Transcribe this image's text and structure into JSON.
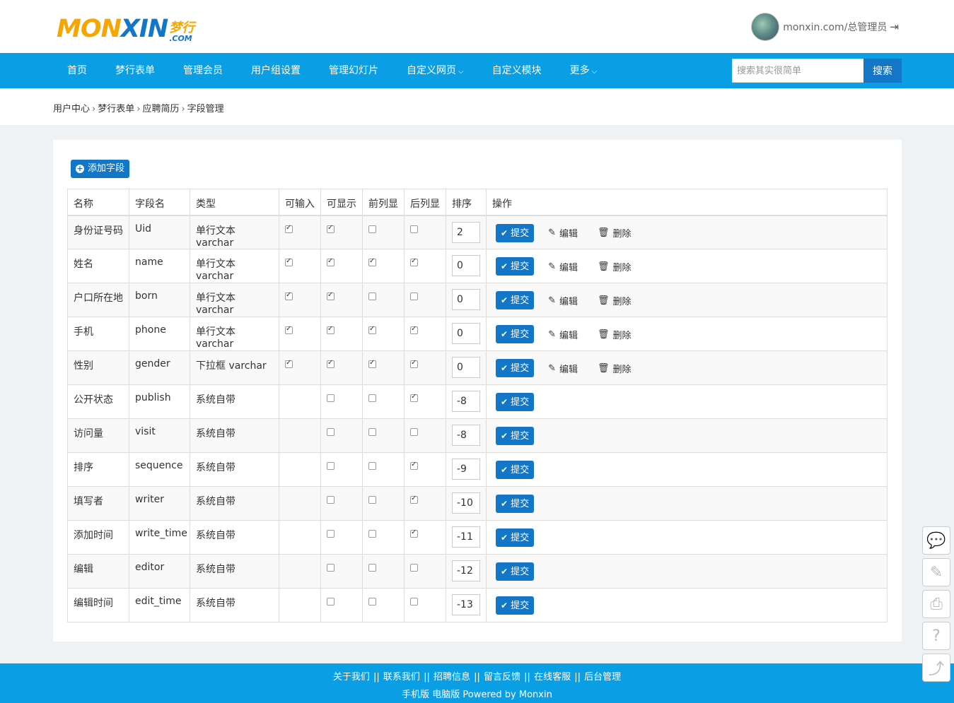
{
  "brand": {
    "mon": "MON",
    "xin": "XIN",
    "cn": "梦行",
    "com": ".COM"
  },
  "user": {
    "label": "monxin.com/总管理员",
    "logout_icon": "sign-out-icon"
  },
  "nav": {
    "items": [
      {
        "label": "首页",
        "dropdown": false
      },
      {
        "label": "梦行表单",
        "dropdown": false
      },
      {
        "label": "管理会员",
        "dropdown": false
      },
      {
        "label": "用户组设置",
        "dropdown": false
      },
      {
        "label": "管理幻灯片",
        "dropdown": false
      },
      {
        "label": "自定义网页",
        "dropdown": true
      },
      {
        "label": "自定义模块",
        "dropdown": false
      },
      {
        "label": "更多",
        "dropdown": true
      }
    ],
    "search_placeholder": "搜索其实很简单",
    "search_button": "搜索"
  },
  "breadcrumb": [
    "用户中心",
    "梦行表单",
    "应聘简历",
    "字段管理"
  ],
  "add_button": "添加字段",
  "table": {
    "headers": [
      "名称",
      "字段名",
      "类型",
      "可输入",
      "可显示",
      "前列显",
      "后列显",
      "排序",
      "操作"
    ],
    "rows": [
      {
        "name": "身份证号码",
        "field": "Uid",
        "type": "单行文本 varchar",
        "input": true,
        "show": true,
        "front": false,
        "back": false,
        "seq": "2",
        "editable": true
      },
      {
        "name": "姓名",
        "field": "name",
        "type": "单行文本 varchar",
        "input": true,
        "show": true,
        "front": true,
        "back": true,
        "seq": "0",
        "editable": true
      },
      {
        "name": "户口所在地",
        "field": "born",
        "type": "单行文本 varchar",
        "input": true,
        "show": true,
        "front": false,
        "back": false,
        "seq": "0",
        "editable": true
      },
      {
        "name": "手机",
        "field": "phone",
        "type": "单行文本 varchar",
        "input": true,
        "show": true,
        "front": true,
        "back": true,
        "seq": "0",
        "editable": true
      },
      {
        "name": "性别",
        "field": "gender",
        "type": "下拉框 varchar",
        "input": true,
        "show": true,
        "front": true,
        "back": true,
        "seq": "0",
        "editable": true
      },
      {
        "name": "公开状态",
        "field": "publish",
        "type": "系统自带",
        "input": null,
        "show": false,
        "front": false,
        "back": true,
        "seq": "-8",
        "editable": false
      },
      {
        "name": "访问量",
        "field": "visit",
        "type": "系统自带",
        "input": null,
        "show": false,
        "front": false,
        "back": false,
        "seq": "-8",
        "editable": false
      },
      {
        "name": "排序",
        "field": "sequence",
        "type": "系统自带",
        "input": null,
        "show": false,
        "front": false,
        "back": true,
        "seq": "-9",
        "editable": false
      },
      {
        "name": "填写者",
        "field": "writer",
        "type": "系统自带",
        "input": null,
        "show": false,
        "front": false,
        "back": true,
        "seq": "-10",
        "editable": false
      },
      {
        "name": "添加时间",
        "field": "write_time",
        "type": "系统自带",
        "input": null,
        "show": false,
        "front": false,
        "back": true,
        "seq": "-11",
        "editable": false
      },
      {
        "name": "编辑",
        "field": "editor",
        "type": "系统自带",
        "input": null,
        "show": false,
        "front": false,
        "back": false,
        "seq": "-12",
        "editable": false
      },
      {
        "name": "编辑时间",
        "field": "edit_time",
        "type": "系统自带",
        "input": null,
        "show": false,
        "front": false,
        "back": false,
        "seq": "-13",
        "editable": false
      }
    ],
    "submit_label": "提交",
    "edit_label": "编辑",
    "delete_label": "删除"
  },
  "footer": {
    "links": [
      "关于我们",
      "联系我们",
      "招聘信息",
      "留言反馈",
      "在线客服",
      "后台管理"
    ],
    "sub": "手机版 电脑版 Powered by Monxin"
  },
  "side_tools": [
    "wechat-icon",
    "pencil-icon",
    "print-icon",
    "help-icon",
    "share-icon"
  ]
}
